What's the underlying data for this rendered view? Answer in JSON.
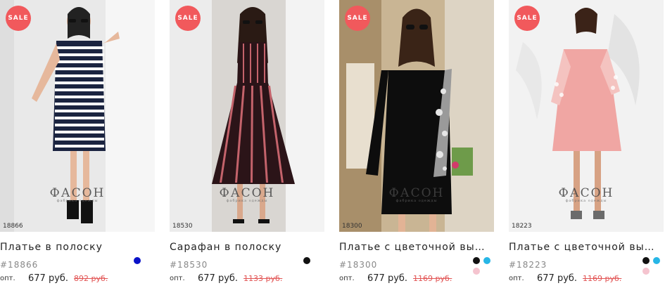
{
  "products": [
    {
      "sale": "SALE",
      "overlay_sku": "18866",
      "title": "Платье в полоску",
      "sku": "#18866",
      "opt_label": "опт.",
      "price": "677 руб.",
      "old_price": "892 руб.",
      "swatches": [
        {
          "name": "blue",
          "color": "#0a12c8"
        }
      ]
    },
    {
      "sale": "SALE",
      "overlay_sku": "18530",
      "title": "Сарафан в полоску",
      "sku": "#18530",
      "opt_label": "опт.",
      "price": "677 руб.",
      "old_price": "1133 руб.",
      "swatches": [
        {
          "name": "black",
          "color": "#111111"
        }
      ]
    },
    {
      "sale": "SALE",
      "overlay_sku": "18300",
      "title": "Платье с цветочной выш…",
      "sku": "#18300",
      "opt_label": "опт.",
      "price": "677 руб.",
      "old_price": "1169 руб.",
      "swatches": [
        {
          "name": "black",
          "color": "#111111"
        },
        {
          "name": "cyan",
          "color": "#27b6e6"
        },
        {
          "name": "pink",
          "color": "#f5c4cf"
        }
      ]
    },
    {
      "sale": "SALE",
      "overlay_sku": "18223",
      "title": "Платье с цветочной выш…",
      "sku": "#18223",
      "opt_label": "опт.",
      "price": "677 руб.",
      "old_price": "1169 руб.",
      "swatches": [
        {
          "name": "black",
          "color": "#111111"
        },
        {
          "name": "cyan",
          "color": "#27b6e6"
        },
        {
          "name": "pink",
          "color": "#f5c4cf"
        }
      ]
    }
  ],
  "brand": {
    "logo": "ФАСОН",
    "tagline": "фабрика одежды"
  },
  "colors": {
    "sale_badge": "#f1595c",
    "old_price": "#e25454"
  }
}
